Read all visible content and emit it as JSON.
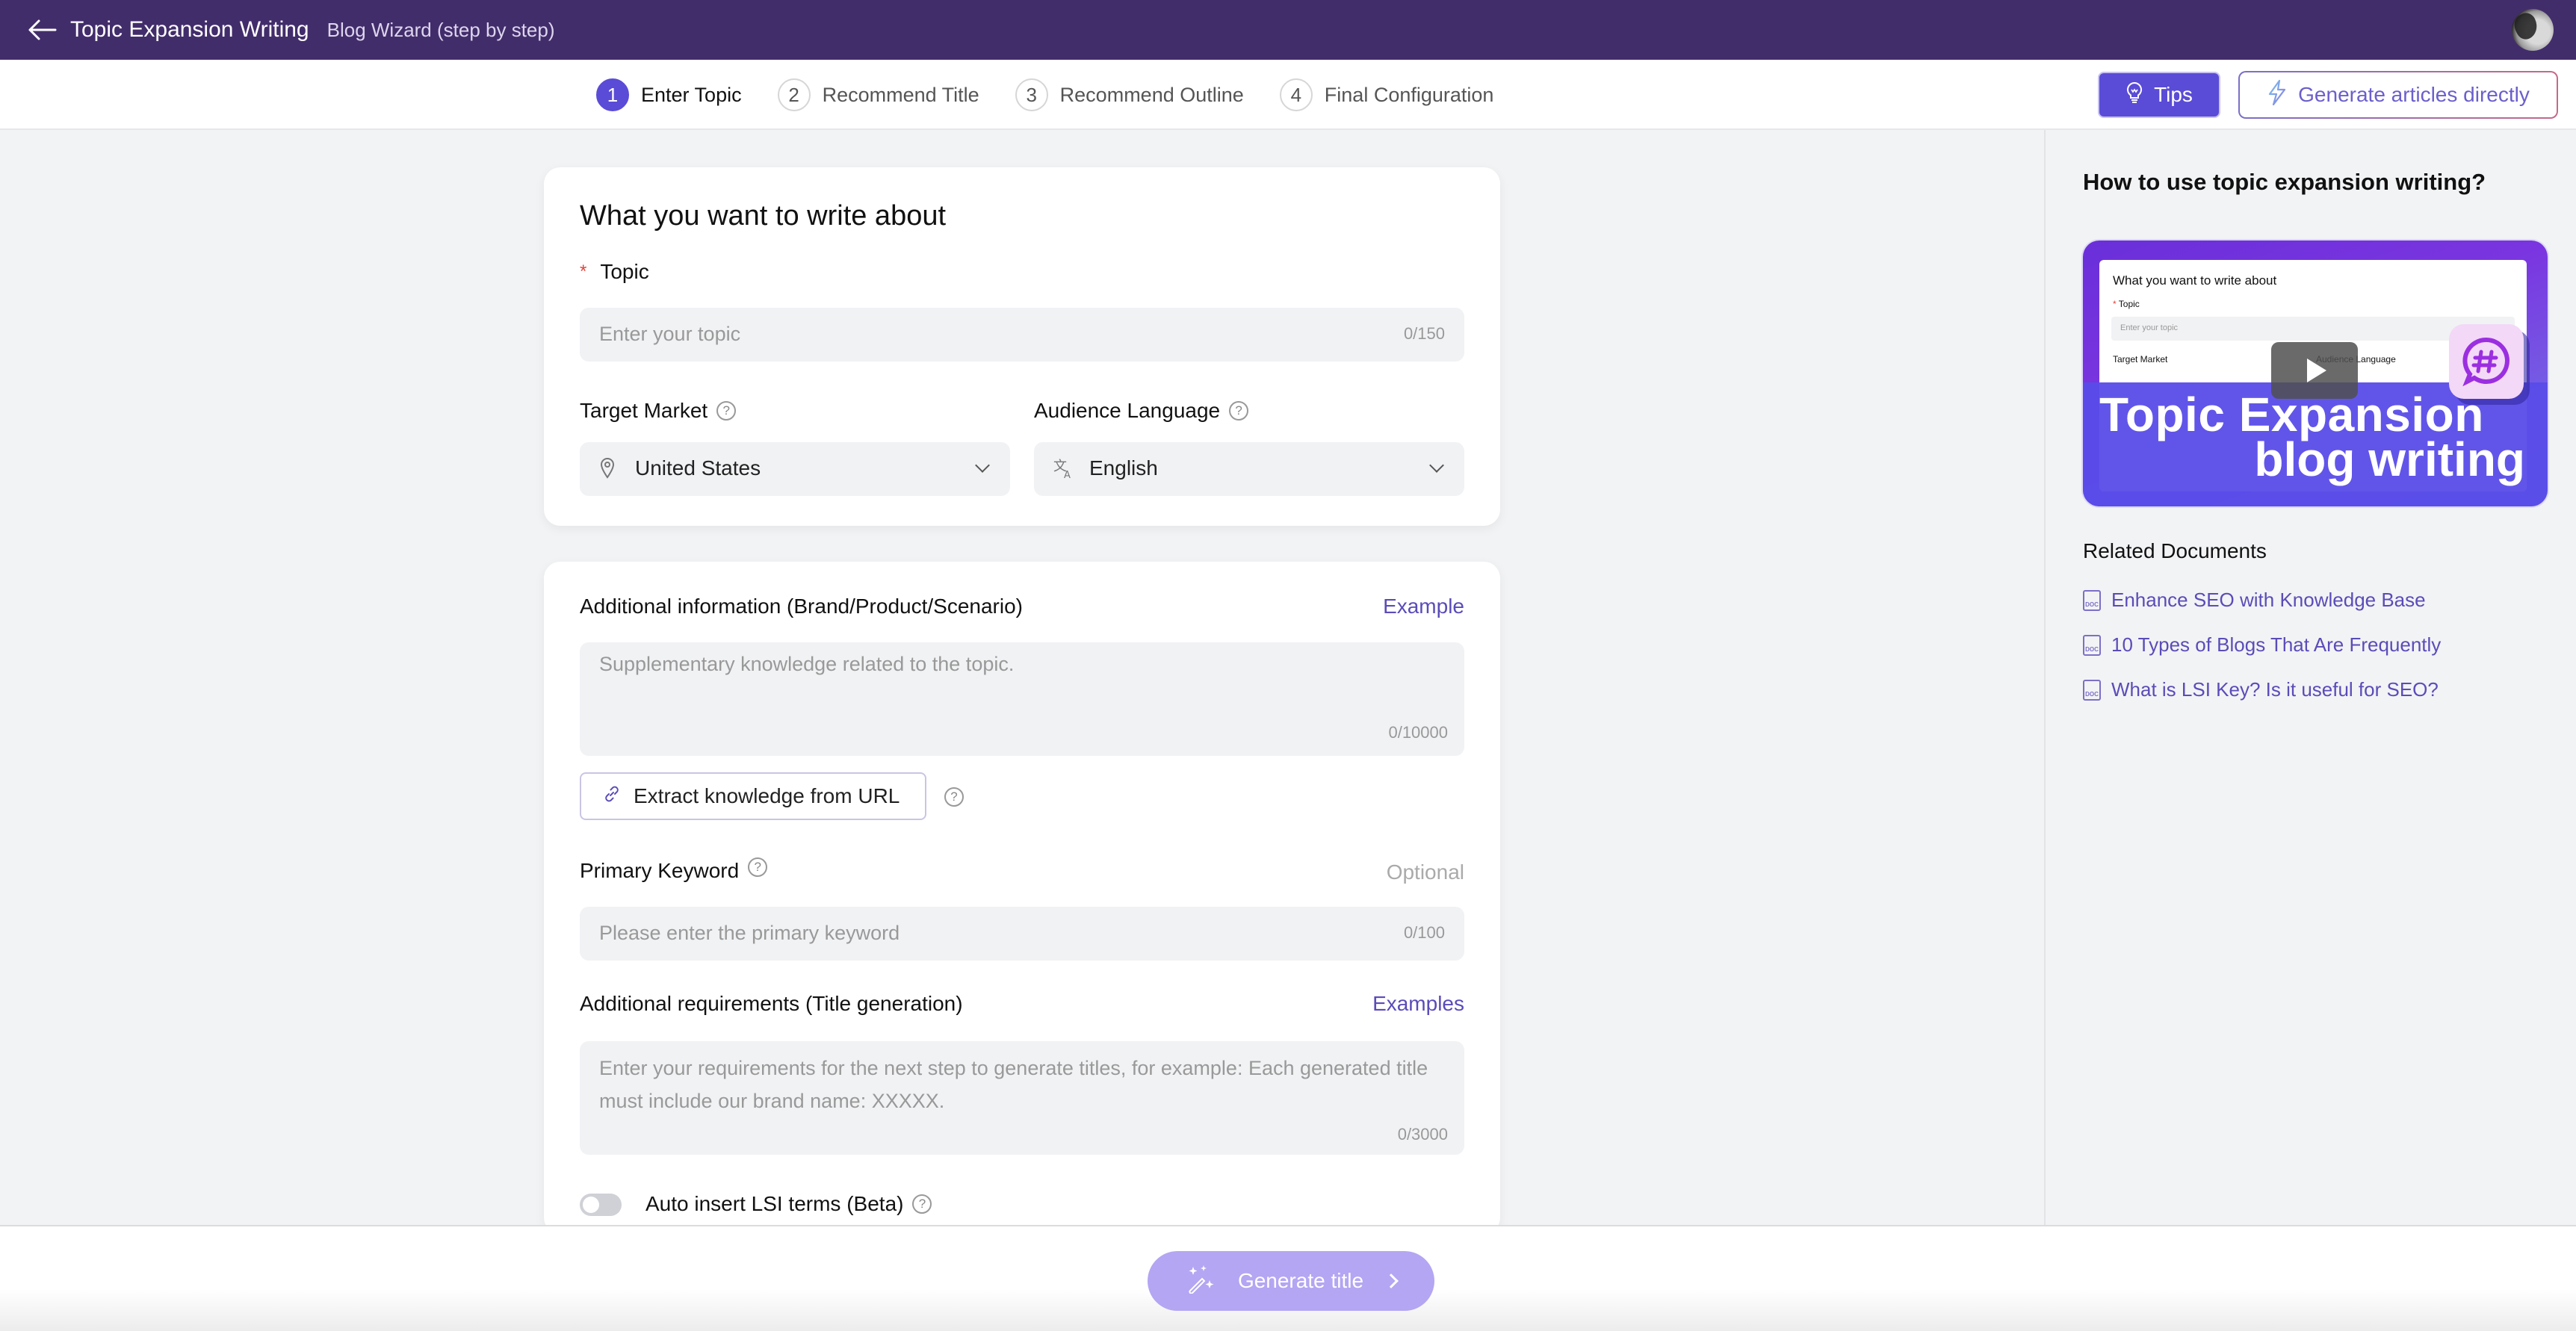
{
  "header": {
    "title": "Topic Expansion Writing",
    "subtitle": "Blog Wizard (step by step)"
  },
  "steps": [
    {
      "num": "1",
      "label": "Enter Topic",
      "active": true
    },
    {
      "num": "2",
      "label": "Recommend Title",
      "active": false
    },
    {
      "num": "3",
      "label": "Recommend Outline",
      "active": false
    },
    {
      "num": "4",
      "label": "Final Configuration",
      "active": false
    }
  ],
  "toolbar": {
    "tips_label": "Tips",
    "generate_direct_label": "Generate articles directly"
  },
  "form": {
    "card_title": "What you want to write about",
    "topic": {
      "label": "Topic",
      "required_mark": "*",
      "placeholder": "Enter your topic",
      "counter": "0/150"
    },
    "target_market": {
      "label": "Target Market",
      "value": "United States"
    },
    "audience_language": {
      "label": "Audience Language",
      "value": "English"
    },
    "additional_info": {
      "label": "Additional information (Brand/Product/Scenario)",
      "link": "Example",
      "placeholder": "Supplementary knowledge related to the topic.",
      "counter": "0/10000"
    },
    "extract_button": "Extract knowledge from URL",
    "primary_keyword": {
      "label": "Primary Keyword",
      "hint": "Optional",
      "placeholder": "Please enter the primary keyword",
      "counter": "0/100"
    },
    "additional_requirements": {
      "label": "Additional requirements (Title generation)",
      "link": "Examples",
      "placeholder": "Enter your requirements for the next step to generate titles, for example: Each generated title must include our brand name: XXXXX.",
      "counter": "0/3000"
    },
    "lsi_toggle": {
      "label": "Auto insert LSI terms (Beta)",
      "on": false
    }
  },
  "footer": {
    "generate_title_label": "Generate title"
  },
  "sidebar": {
    "title": "How to use topic expansion writing?",
    "video": {
      "line1": "Topic Expansion",
      "line2": "blog writing",
      "preview_title": "What you want to write about",
      "preview_topic": "Topic",
      "preview_placeholder": "Enter your topic",
      "preview_target_market": "Target Market",
      "preview_audience_language": "Audience Language"
    },
    "related_title": "Related Documents",
    "documents": [
      {
        "title": "Enhance SEO with Knowledge Base"
      },
      {
        "title": "10 Types of Blogs That Are Frequently"
      },
      {
        "title": "What is LSI Key? Is it useful for SEO?"
      }
    ]
  },
  "colors": {
    "header_bg": "#422d6b",
    "accent": "#5a4cd6",
    "link": "#5a4cb8",
    "generate_button_disabled": "#b4a6f2"
  }
}
